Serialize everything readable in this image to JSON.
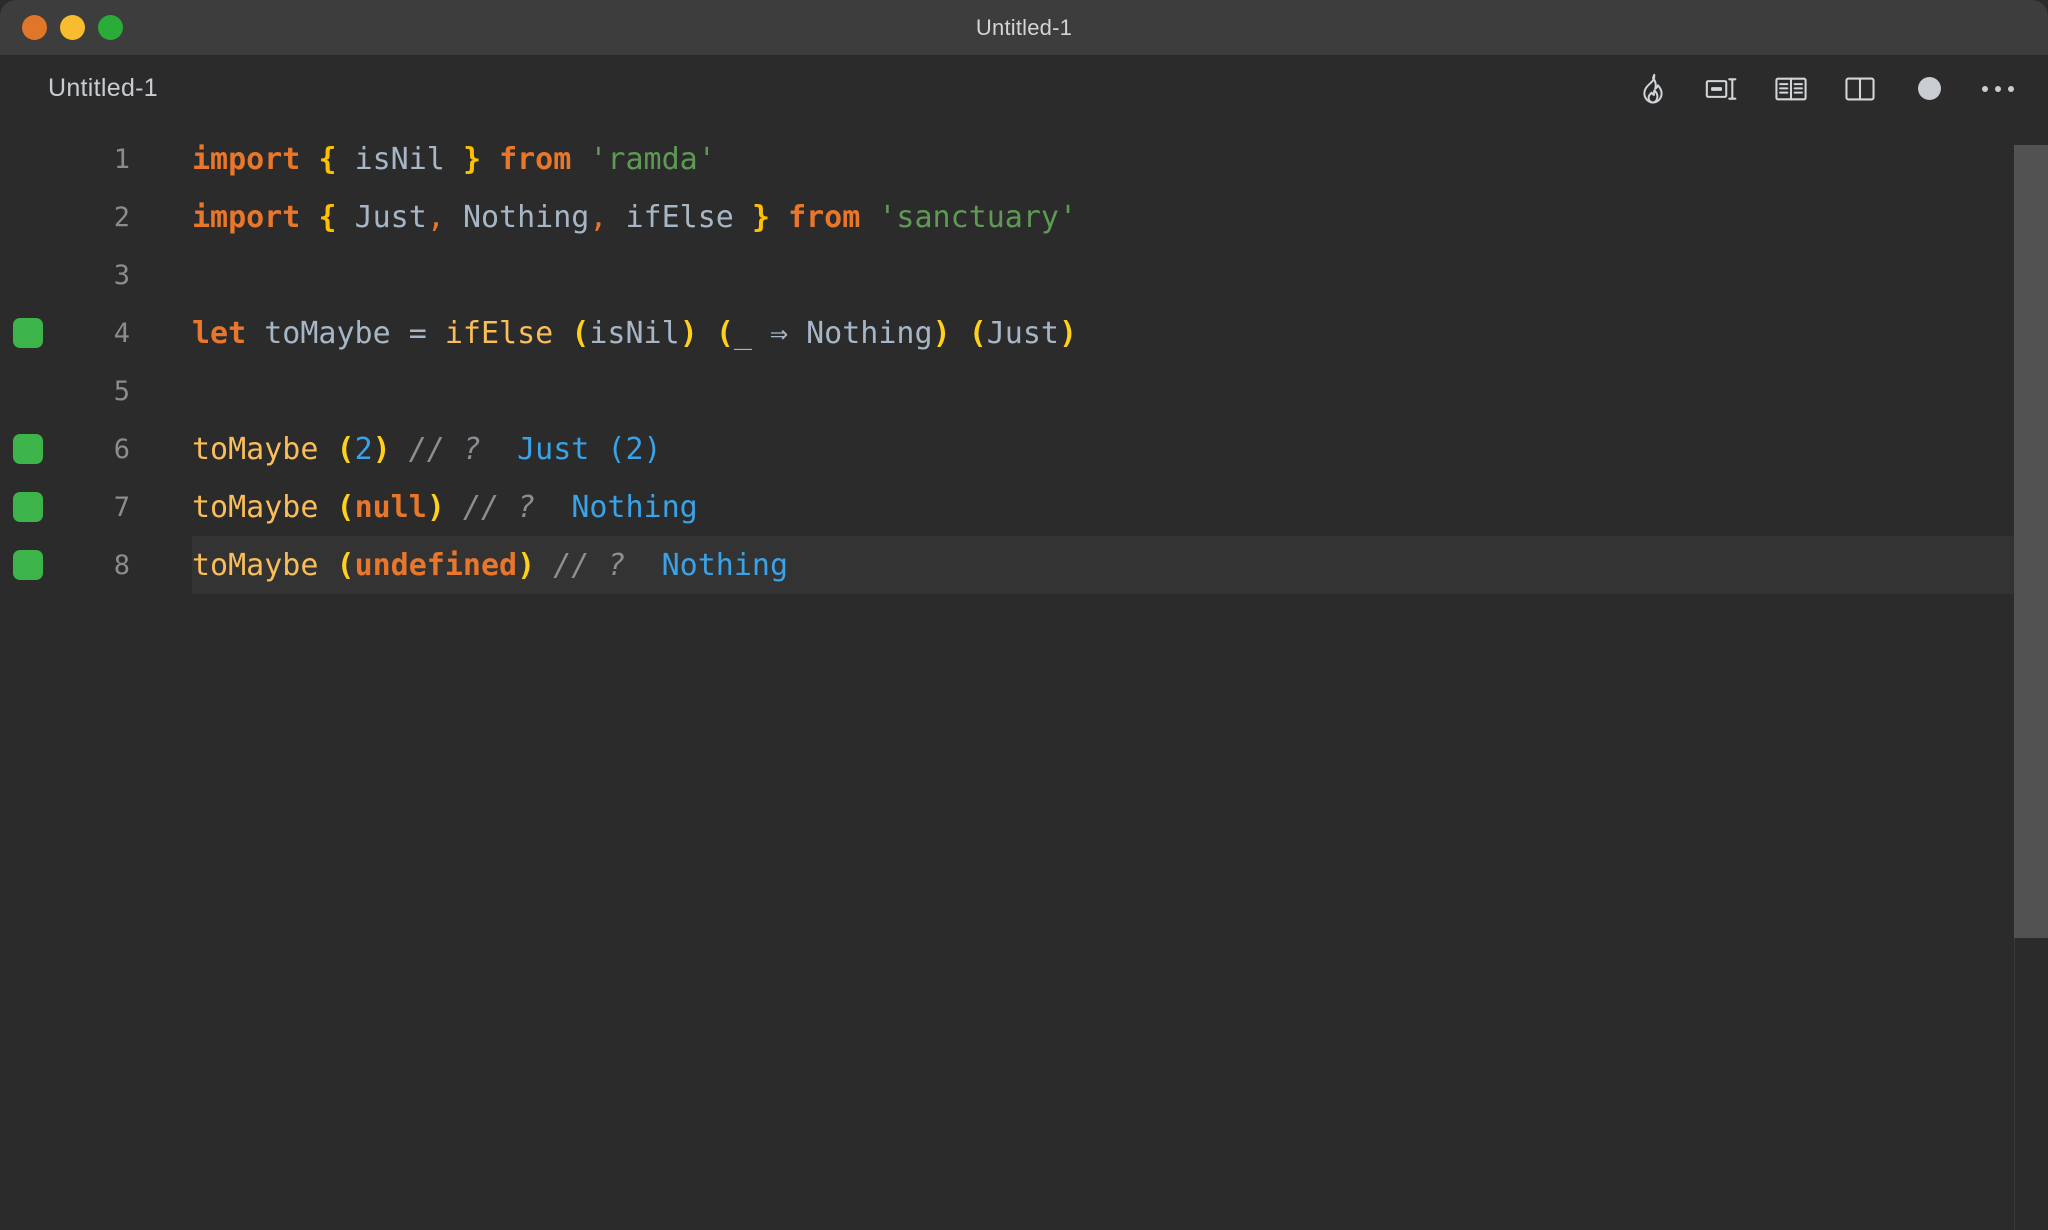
{
  "window": {
    "title": "Untitled-1",
    "traffic_lights": [
      {
        "name": "close",
        "color": "#e0762a"
      },
      {
        "name": "minimize",
        "color": "#f7bd2e"
      },
      {
        "name": "maximize",
        "color": "#2aac38"
      }
    ]
  },
  "tabbar": {
    "tab_label": "Untitled-1",
    "toolbar_icons": [
      {
        "name": "flame-icon",
        "title": "Run / Quokka"
      },
      {
        "name": "split-editor-right-icon",
        "title": "Split Editor"
      },
      {
        "name": "open-book-icon",
        "title": "Open Preview"
      },
      {
        "name": "split-panel-icon",
        "title": "Toggle Layout"
      },
      {
        "name": "record-dot-icon",
        "title": "Record"
      },
      {
        "name": "more-actions-icon",
        "title": "More Actions"
      }
    ]
  },
  "editor": {
    "theme_background": "#2b2b2b",
    "active_line_background": "#333333",
    "marker_color": "#3cb44a",
    "active_line": 8,
    "lines": [
      {
        "number": "1",
        "marker": false,
        "active": false,
        "tokens": [
          {
            "cls": "kw",
            "t": "import"
          },
          {
            "cls": "plain",
            "t": " "
          },
          {
            "cls": "brace",
            "t": "{"
          },
          {
            "cls": "plain",
            "t": " "
          },
          {
            "cls": "ident",
            "t": "isNil"
          },
          {
            "cls": "plain",
            "t": " "
          },
          {
            "cls": "brace",
            "t": "}"
          },
          {
            "cls": "plain",
            "t": " "
          },
          {
            "cls": "kw",
            "t": "from"
          },
          {
            "cls": "plain",
            "t": " "
          },
          {
            "cls": "str",
            "t": "'ramda'"
          }
        ]
      },
      {
        "number": "2",
        "marker": false,
        "active": false,
        "tokens": [
          {
            "cls": "kw",
            "t": "import"
          },
          {
            "cls": "plain",
            "t": " "
          },
          {
            "cls": "brace",
            "t": "{"
          },
          {
            "cls": "plain",
            "t": " "
          },
          {
            "cls": "ident",
            "t": "Just"
          },
          {
            "cls": "punc",
            "t": ","
          },
          {
            "cls": "plain",
            "t": " "
          },
          {
            "cls": "ident",
            "t": "Nothing"
          },
          {
            "cls": "punc",
            "t": ","
          },
          {
            "cls": "plain",
            "t": " "
          },
          {
            "cls": "ident",
            "t": "ifElse"
          },
          {
            "cls": "plain",
            "t": " "
          },
          {
            "cls": "brace",
            "t": "}"
          },
          {
            "cls": "plain",
            "t": " "
          },
          {
            "cls": "kw",
            "t": "from"
          },
          {
            "cls": "plain",
            "t": " "
          },
          {
            "cls": "str",
            "t": "'sanctuary'"
          }
        ]
      },
      {
        "number": "3",
        "marker": false,
        "active": false,
        "tokens": []
      },
      {
        "number": "4",
        "marker": true,
        "active": false,
        "tokens": [
          {
            "cls": "kw",
            "t": "let"
          },
          {
            "cls": "plain",
            "t": " "
          },
          {
            "cls": "ident",
            "t": "toMaybe"
          },
          {
            "cls": "plain",
            "t": " "
          },
          {
            "cls": "eq",
            "t": "="
          },
          {
            "cls": "plain",
            "t": " "
          },
          {
            "cls": "func",
            "t": "ifElse"
          },
          {
            "cls": "plain",
            "t": " "
          },
          {
            "cls": "paren",
            "t": "("
          },
          {
            "cls": "ident",
            "t": "isNil"
          },
          {
            "cls": "paren",
            "t": ")"
          },
          {
            "cls": "plain",
            "t": " "
          },
          {
            "cls": "paren",
            "t": "("
          },
          {
            "cls": "ident",
            "t": "_"
          },
          {
            "cls": "plain",
            "t": " "
          },
          {
            "cls": "arrow",
            "t": "⇒"
          },
          {
            "cls": "plain",
            "t": " "
          },
          {
            "cls": "ident",
            "t": "Nothing"
          },
          {
            "cls": "paren",
            "t": ")"
          },
          {
            "cls": "plain",
            "t": " "
          },
          {
            "cls": "paren",
            "t": "("
          },
          {
            "cls": "ident",
            "t": "Just"
          },
          {
            "cls": "paren",
            "t": ")"
          }
        ]
      },
      {
        "number": "5",
        "marker": false,
        "active": false,
        "tokens": []
      },
      {
        "number": "6",
        "marker": true,
        "active": false,
        "tokens": [
          {
            "cls": "func",
            "t": "toMaybe"
          },
          {
            "cls": "plain",
            "t": " "
          },
          {
            "cls": "paren",
            "t": "("
          },
          {
            "cls": "num",
            "t": "2"
          },
          {
            "cls": "paren",
            "t": ")"
          },
          {
            "cls": "plain",
            "t": " "
          },
          {
            "cls": "cmt",
            "t": "// ?"
          },
          {
            "cls": "plain",
            "t": "  "
          },
          {
            "cls": "type",
            "t": "Just (2)"
          }
        ]
      },
      {
        "number": "7",
        "marker": true,
        "active": false,
        "tokens": [
          {
            "cls": "func",
            "t": "toMaybe"
          },
          {
            "cls": "plain",
            "t": " "
          },
          {
            "cls": "paren",
            "t": "("
          },
          {
            "cls": "orangeval",
            "t": "null"
          },
          {
            "cls": "paren",
            "t": ")"
          },
          {
            "cls": "plain",
            "t": " "
          },
          {
            "cls": "cmt",
            "t": "// ?"
          },
          {
            "cls": "plain",
            "t": "  "
          },
          {
            "cls": "type",
            "t": "Nothing"
          }
        ]
      },
      {
        "number": "8",
        "marker": true,
        "active": true,
        "tokens": [
          {
            "cls": "func",
            "t": "toMaybe"
          },
          {
            "cls": "plain",
            "t": " "
          },
          {
            "cls": "paren",
            "t": "("
          },
          {
            "cls": "orangeval",
            "t": "undefined"
          },
          {
            "cls": "paren",
            "t": ")"
          },
          {
            "cls": "plain",
            "t": " "
          },
          {
            "cls": "cmt",
            "t": "// ?"
          },
          {
            "cls": "plain",
            "t": "  "
          },
          {
            "cls": "type",
            "t": "Nothing"
          }
        ]
      }
    ]
  }
}
